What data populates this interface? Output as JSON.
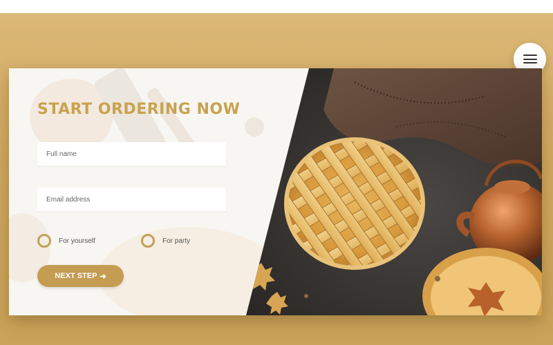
{
  "menu": {
    "icon": "hamburger-menu-icon"
  },
  "form": {
    "title": "START ORDERING NOW",
    "full_name_placeholder": "Full name",
    "email_placeholder": "Email address",
    "options": [
      {
        "label": "For yourself"
      },
      {
        "label": "For party"
      }
    ],
    "next_label": "NEXT STEP",
    "next_icon": "arrow-right-icon",
    "next_arrow": "➔"
  },
  "colors": {
    "accent": "#c9a24e",
    "button": "#c49c52",
    "background": "#d4ae68"
  }
}
